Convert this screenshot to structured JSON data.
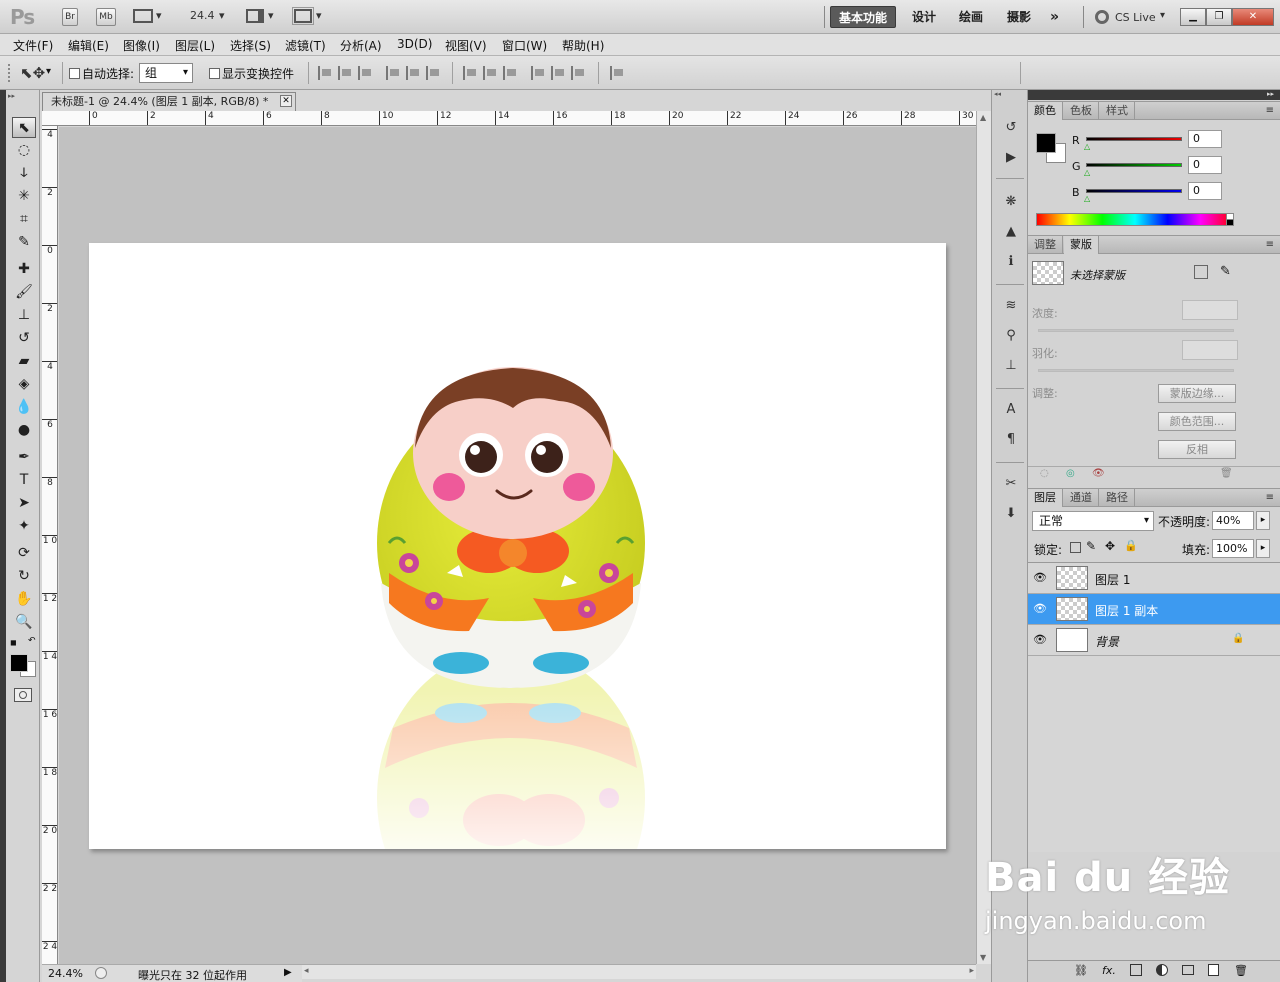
{
  "app": {
    "logo": "Ps",
    "bridge_btn": "Br",
    "minibridge_btn": "Mb",
    "zoom_value": "24.4",
    "workspaces": [
      "基本功能",
      "设计",
      "绘画",
      "摄影"
    ],
    "more_workspaces": "»",
    "cs_live": "CS Live"
  },
  "menu": [
    "文件(F)",
    "编辑(E)",
    "图像(I)",
    "图层(L)",
    "选择(S)",
    "滤镜(T)",
    "分析(A)",
    "3D(D)",
    "视图(V)",
    "窗口(W)",
    "帮助(H)"
  ],
  "options": {
    "auto_select_label": "自动选择:",
    "auto_select_value": "组",
    "show_transform_label": "显示变换控件"
  },
  "document": {
    "tab_title": "未标题-1 @ 24.4% (图层 1 副本, RGB/8) *",
    "ruler_top": [
      "0",
      "2",
      "4",
      "6",
      "8",
      "10",
      "12",
      "14",
      "16",
      "18",
      "20",
      "22",
      "24",
      "26",
      "28",
      "30"
    ],
    "ruler_left": [
      "4",
      "2",
      "0",
      "2",
      "4",
      "6",
      "8",
      "1 0",
      "1 2",
      "1 4",
      "1 6",
      "1 8",
      "2 0",
      "2 2",
      "2 4"
    ]
  },
  "status": {
    "zoom": "24.4%",
    "message": "曝光只在 32 位起作用"
  },
  "color_panel": {
    "tabs": [
      "颜色",
      "色板",
      "样式"
    ],
    "channels": [
      {
        "label": "R",
        "value": "0",
        "color": "#d81c1c"
      },
      {
        "label": "G",
        "value": "0",
        "color": "#1cb81c"
      },
      {
        "label": "B",
        "value": "0",
        "color": "#1c1cd8"
      }
    ]
  },
  "masks_panel": {
    "tabs": [
      "调整",
      "蒙版"
    ],
    "no_mask": "未选择蒙版",
    "density_label": "浓度:",
    "feather_label": "羽化:",
    "refine_label": "调整:",
    "mask_edge_btn": "蒙版边缘...",
    "color_range_btn": "颜色范围...",
    "invert_btn": "反相"
  },
  "layers_panel": {
    "tabs": [
      "图层",
      "通道",
      "路径"
    ],
    "blend_mode": "正常",
    "opacity_label": "不透明度:",
    "opacity_value": "40%",
    "lock_label": "锁定:",
    "fill_label": "填充:",
    "fill_value": "100%",
    "layers": [
      {
        "name": "图层 1",
        "selected": false
      },
      {
        "name": "图层 1 副本",
        "selected": true
      },
      {
        "name": "背景",
        "selected": false
      }
    ],
    "footer_icons": [
      "link-icon",
      "fx-icon",
      "mask-icon",
      "adjustment-icon",
      "group-icon",
      "new-layer-icon",
      "trash-icon"
    ]
  },
  "watermark": {
    "brand": "Bai du 经验",
    "url": "jingyan.baidu.com"
  }
}
